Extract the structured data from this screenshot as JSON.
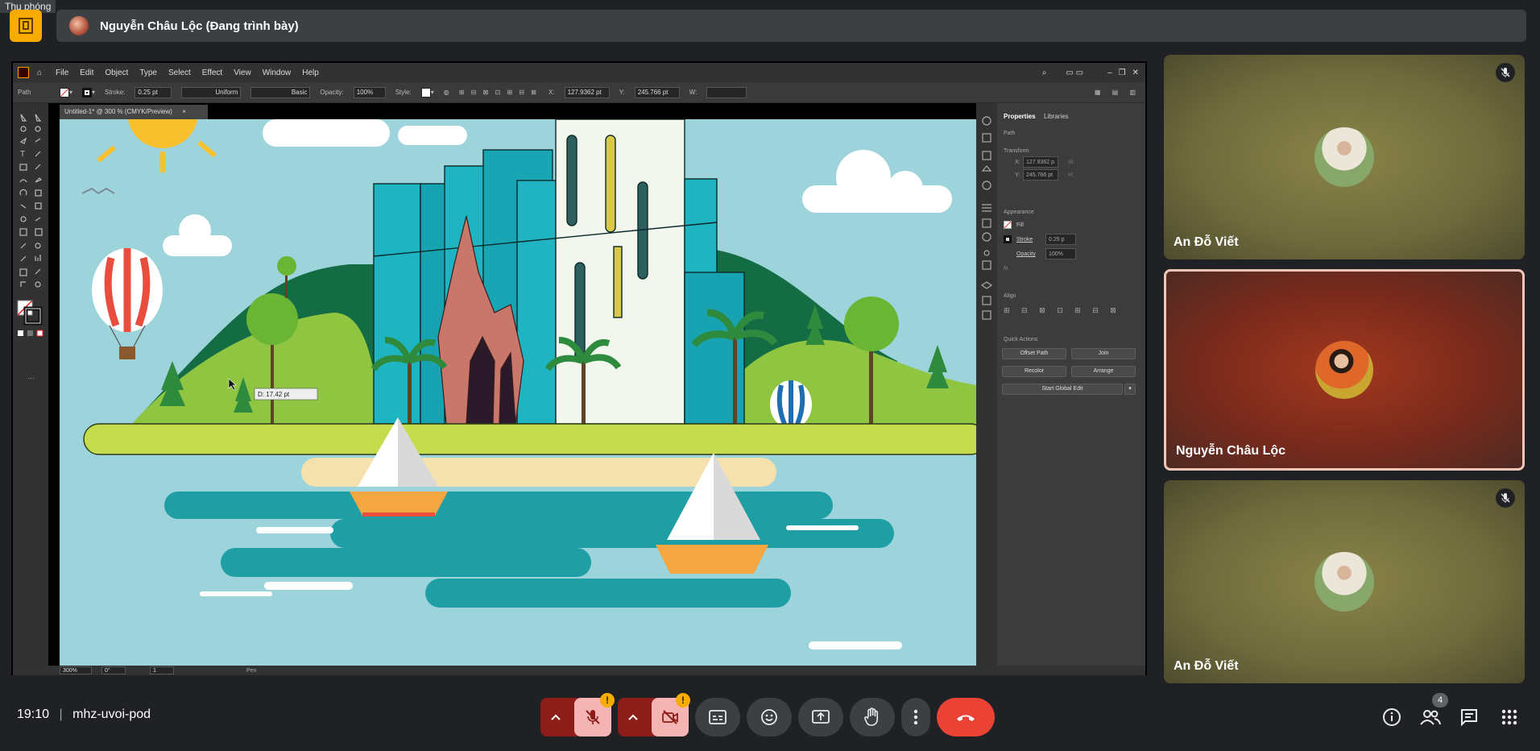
{
  "meeting": {
    "minimize_label": "Thu phóng",
    "presenter_label": "Nguyễn Châu Lộc (Đang trình bày)",
    "clock": "19:10",
    "separator": "|",
    "meeting_code": "mhz-uvoi-pod",
    "participant_count": "4"
  },
  "participants": [
    {
      "name": "An Đỗ Viết",
      "muted": true
    },
    {
      "name": "Nguyễn Châu Lộc",
      "muted": false,
      "active_speaker": true
    },
    {
      "name": "An Đỗ Viết",
      "muted": true
    }
  ],
  "illustrator": {
    "menu": [
      "File",
      "Edit",
      "Object",
      "Type",
      "Select",
      "Effect",
      "View",
      "Window",
      "Help"
    ],
    "control": {
      "selection": "Path",
      "stroke_label": "Stroke:",
      "stroke_value": "0.25 pt",
      "profile": "Uniform",
      "brush": "Basic",
      "opacity_label": "Opacity:",
      "opacity_value": "100%",
      "style_label": "Style:",
      "x_label": "X:",
      "x_value": "127.9362 pt",
      "y_label": "Y:",
      "y_value": "245.766 pt",
      "w_label": "W:"
    },
    "doc_tab": "Untitled-1* @ 300 % (CMYK/Preview)",
    "distance_tooltip": "D: 17.42 pt",
    "panel": {
      "tabs": [
        "Properties",
        "Libraries"
      ],
      "path": "Path",
      "transform": "Transform",
      "x_label": "X:",
      "x_value": "127.9362 p",
      "y_label": "Y:",
      "y_value": "245.766 pt",
      "w_label": "W:",
      "h_label": "H:",
      "appearance": "Appearance",
      "fill": "Fill",
      "stroke": "Stroke",
      "stroke_value": "0.25 p",
      "opacity": "Opacity",
      "opacity_value": "100%",
      "fx": "fx.",
      "align": "Align",
      "quick_actions": "Quick Actions",
      "offset_path": "Offset Path",
      "join": "Join",
      "recolor": "Recolor",
      "arrange": "Arrange",
      "global_edit": "Start Global Edit"
    },
    "status": {
      "zoom": "300%",
      "rotate": "0°",
      "artboard": "1",
      "tool": "Pen"
    }
  },
  "colors": {
    "mic_off": "#f4b4b4",
    "end_call": "#ea4335",
    "warning": "#f9ab00",
    "accent_border": "#f5c6b8"
  }
}
